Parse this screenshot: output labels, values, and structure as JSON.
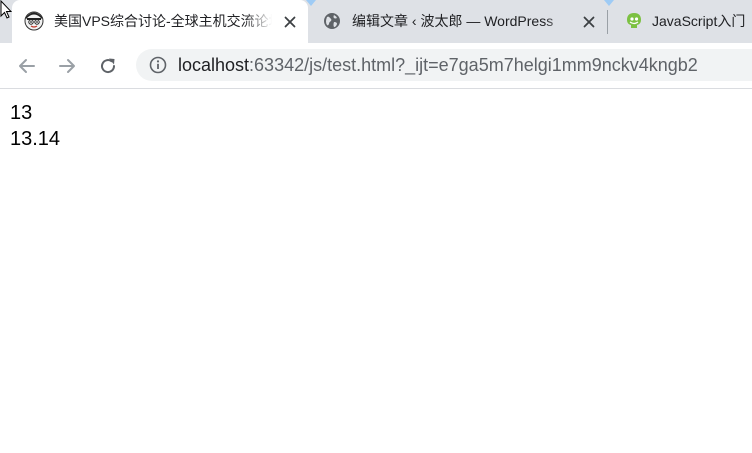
{
  "tabs": [
    {
      "title": "美国VPS综合讨论-全球主机交流论坛",
      "favicon": "hostloc-avatar-icon",
      "active": true
    },
    {
      "title": "编辑文章 ‹ 波太郎 — WordPress",
      "favicon": "globe-icon",
      "active": false
    },
    {
      "title": "JavaScript入门",
      "favicon": "tutorial-site-icon",
      "active": false
    }
  ],
  "address_bar": {
    "host": "localhost",
    "path": ":63342/js/test.html?_ijt=e7ga5m7helgi1mm9nckv4kngb2"
  },
  "page": {
    "lines": [
      "13",
      "13.14"
    ]
  },
  "colors": {
    "tabstrip": "#dee1e6",
    "omnibox": "#f1f3f4",
    "icon": "#5f6368",
    "disabled_icon": "#9aa0a6"
  }
}
